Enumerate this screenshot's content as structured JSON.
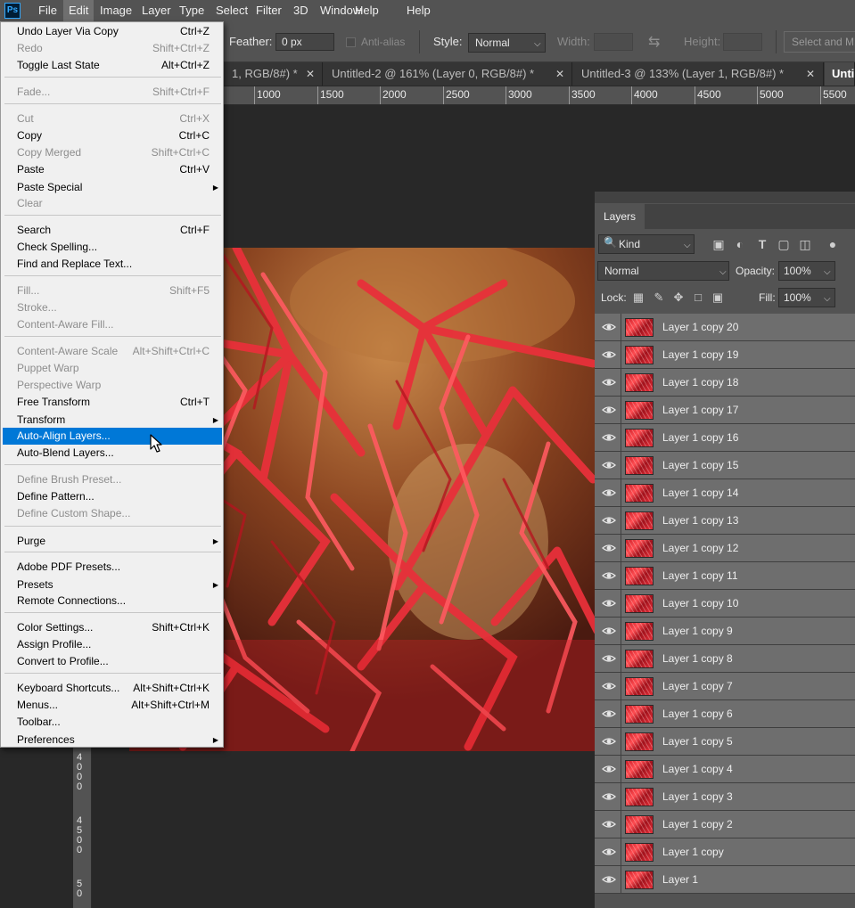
{
  "menubar": {
    "logo": "Ps",
    "items": [
      {
        "label": "File",
        "active": false
      },
      {
        "label": "Edit",
        "active": true
      },
      {
        "label": "Image",
        "active": false
      },
      {
        "label": "Layer",
        "active": false
      },
      {
        "label": "Type",
        "active": false
      },
      {
        "label": "Select",
        "active": false
      },
      {
        "label": "Filter",
        "active": false
      },
      {
        "label": "3D",
        "active": false
      },
      {
        "label": "Window",
        "active": false
      },
      {
        "label": "Help",
        "active": false
      }
    ]
  },
  "options": {
    "feather_label": "Feather:",
    "feather_value": "0 px",
    "antialias_label": "Anti-alias",
    "style_label": "Style:",
    "style_value": "Normal",
    "width_label": "Width:",
    "height_label": "Height:",
    "select_mask_label": "Select and M"
  },
  "tabs": [
    {
      "label": "1, RGB/8#) *",
      "active": false
    },
    {
      "label": "Untitled-2 @ 161% (Layer 0, RGB/8#) *",
      "active": false
    },
    {
      "label": "Untitled-3 @ 133% (Layer 1, RGB/8#) *",
      "active": false
    },
    {
      "label": "Unti",
      "active": true
    }
  ],
  "ruler": {
    "top": [
      "1000",
      "1500",
      "2000",
      "2500",
      "3000",
      "3500",
      "4000",
      "4500",
      "5000",
      "5500"
    ],
    "left": [
      "4000",
      "4500",
      "50"
    ]
  },
  "edit_menu": {
    "items": [
      {
        "label": "Undo Layer Via Copy",
        "shortcut": "Ctrl+Z",
        "disabled": false
      },
      {
        "label": "Redo",
        "shortcut": "Shift+Ctrl+Z",
        "disabled": true
      },
      {
        "label": "Toggle Last State",
        "shortcut": "Alt+Ctrl+Z",
        "disabled": false
      },
      {
        "label": "Fade...",
        "shortcut": "Shift+Ctrl+F",
        "disabled": true
      },
      {
        "label": "Cut",
        "shortcut": "Ctrl+X",
        "disabled": true
      },
      {
        "label": "Copy",
        "shortcut": "Ctrl+C",
        "disabled": false
      },
      {
        "label": "Copy Merged",
        "shortcut": "Shift+Ctrl+C",
        "disabled": true
      },
      {
        "label": "Paste",
        "shortcut": "Ctrl+V",
        "disabled": false
      },
      {
        "label": "Paste Special",
        "shortcut": "",
        "disabled": false,
        "submenu": true
      },
      {
        "label": "Clear",
        "shortcut": "",
        "disabled": true
      },
      {
        "label": "Search",
        "shortcut": "Ctrl+F",
        "disabled": false
      },
      {
        "label": "Check Spelling...",
        "shortcut": "",
        "disabled": false
      },
      {
        "label": "Find and Replace Text...",
        "shortcut": "",
        "disabled": false
      },
      {
        "label": "Fill...",
        "shortcut": "Shift+F5",
        "disabled": true
      },
      {
        "label": "Stroke...",
        "shortcut": "",
        "disabled": true
      },
      {
        "label": "Content-Aware Fill...",
        "shortcut": "",
        "disabled": true
      },
      {
        "label": "Content-Aware Scale",
        "shortcut": "Alt+Shift+Ctrl+C",
        "disabled": true
      },
      {
        "label": "Puppet Warp",
        "shortcut": "",
        "disabled": true
      },
      {
        "label": "Perspective Warp",
        "shortcut": "",
        "disabled": true
      },
      {
        "label": "Free Transform",
        "shortcut": "Ctrl+T",
        "disabled": false
      },
      {
        "label": "Transform",
        "shortcut": "",
        "disabled": false,
        "submenu": true
      },
      {
        "label": "Auto-Align Layers...",
        "shortcut": "",
        "disabled": false,
        "highlighted": true
      },
      {
        "label": "Auto-Blend Layers...",
        "shortcut": "",
        "disabled": false
      },
      {
        "label": "Define Brush Preset...",
        "shortcut": "",
        "disabled": true
      },
      {
        "label": "Define Pattern...",
        "shortcut": "",
        "disabled": false
      },
      {
        "label": "Define Custom Shape...",
        "shortcut": "",
        "disabled": true
      },
      {
        "label": "Purge",
        "shortcut": "",
        "disabled": false,
        "submenu": true
      },
      {
        "label": "Adobe PDF Presets...",
        "shortcut": "",
        "disabled": false
      },
      {
        "label": "Presets",
        "shortcut": "",
        "disabled": false,
        "submenu": true
      },
      {
        "label": "Remote Connections...",
        "shortcut": "",
        "disabled": false
      },
      {
        "label": "Color Settings...",
        "shortcut": "Shift+Ctrl+K",
        "disabled": false
      },
      {
        "label": "Assign Profile...",
        "shortcut": "",
        "disabled": false
      },
      {
        "label": "Convert to Profile...",
        "shortcut": "",
        "disabled": false
      },
      {
        "label": "Keyboard Shortcuts...",
        "shortcut": "Alt+Shift+Ctrl+K",
        "disabled": false
      },
      {
        "label": "Menus...",
        "shortcut": "Alt+Shift+Ctrl+M",
        "disabled": false
      },
      {
        "label": "Toolbar...",
        "shortcut": "",
        "disabled": false
      },
      {
        "label": "Preferences",
        "shortcut": "",
        "disabled": false,
        "submenu": true
      }
    ]
  },
  "layers_panel": {
    "title": "Layers",
    "filter_kind": "Kind",
    "blend_mode": "Normal",
    "opacity_label": "Opacity:",
    "opacity_value": "100%",
    "lock_label": "Lock:",
    "fill_label": "Fill:",
    "fill_value": "100%",
    "layers": [
      {
        "name": "Layer 1 copy 20",
        "selected": true
      },
      {
        "name": "Layer 1 copy 19",
        "selected": true
      },
      {
        "name": "Layer 1 copy 18",
        "selected": true
      },
      {
        "name": "Layer 1 copy 17",
        "selected": true
      },
      {
        "name": "Layer 1 copy 16",
        "selected": true
      },
      {
        "name": "Layer 1 copy 15",
        "selected": true
      },
      {
        "name": "Layer 1 copy 14",
        "selected": true
      },
      {
        "name": "Layer 1 copy 13",
        "selected": true
      },
      {
        "name": "Layer 1 copy 12",
        "selected": true
      },
      {
        "name": "Layer 1 copy 11",
        "selected": true
      },
      {
        "name": "Layer 1 copy 10",
        "selected": true
      },
      {
        "name": "Layer 1 copy 9",
        "selected": true
      },
      {
        "name": "Layer 1 copy 8",
        "selected": true
      },
      {
        "name": "Layer 1 copy 7",
        "selected": true
      },
      {
        "name": "Layer 1 copy 6",
        "selected": true
      },
      {
        "name": "Layer 1 copy 5",
        "selected": true
      },
      {
        "name": "Layer 1 copy 4",
        "selected": true
      },
      {
        "name": "Layer 1 copy 3",
        "selected": true
      },
      {
        "name": "Layer 1 copy 2",
        "selected": true
      },
      {
        "name": "Layer 1 copy",
        "selected": true
      },
      {
        "name": "Layer 1",
        "selected": true
      }
    ]
  },
  "colors": {
    "menu_highlight": "#0078d7",
    "app_background": "#282828",
    "panel_background": "#535353",
    "leaf_red": "#e8303a"
  },
  "cursor_icon": "arrow-pointer-icon"
}
